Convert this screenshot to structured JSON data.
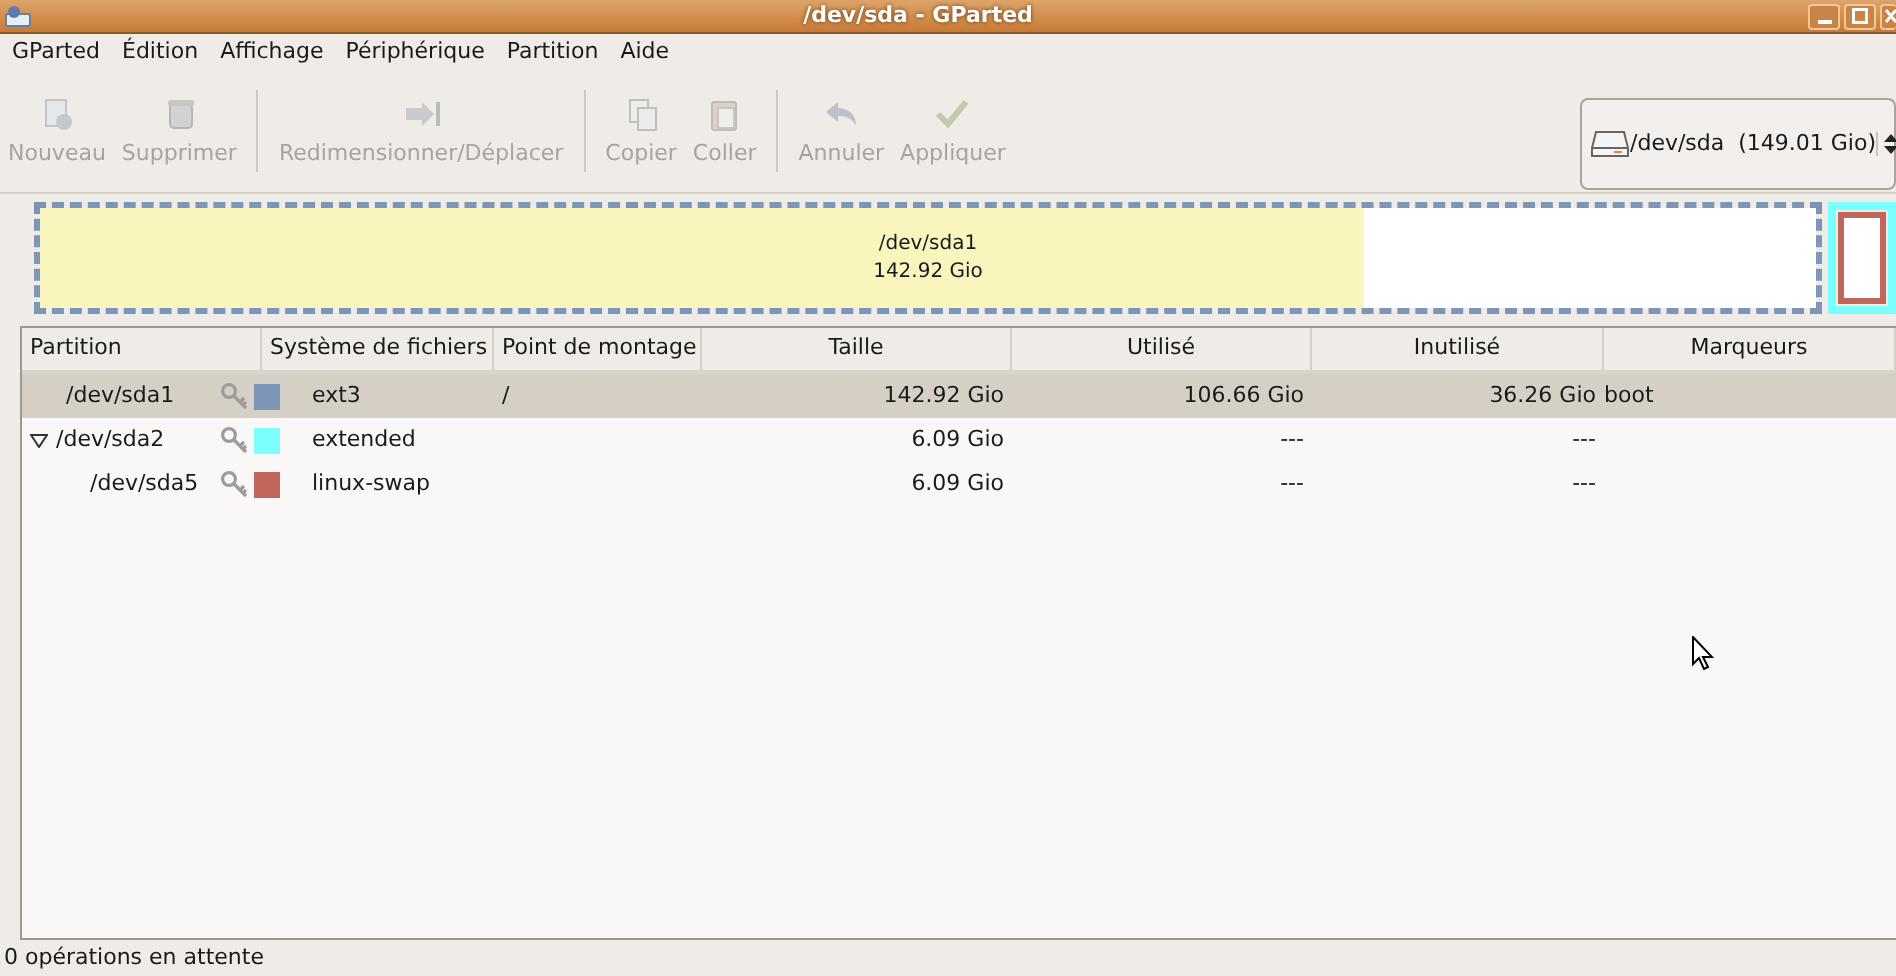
{
  "window": {
    "title": "/dev/sda - GParted"
  },
  "menu": [
    "GParted",
    "Édition",
    "Affichage",
    "Périphérique",
    "Partition",
    "Aide"
  ],
  "toolbar_groups": [
    [
      {
        "label": "Nouveau",
        "disabled": true
      },
      {
        "label": "Supprimer",
        "disabled": true
      }
    ],
    [
      {
        "label": "Redimensionner/Déplacer",
        "disabled": true
      }
    ],
    [
      {
        "label": "Copier",
        "disabled": true
      },
      {
        "label": "Coller",
        "disabled": true
      }
    ],
    [
      {
        "label": "Annuler",
        "disabled": true
      },
      {
        "label": "Appliquer",
        "disabled": true
      }
    ]
  ],
  "device": {
    "value": "/dev/sda  (149.01 Gio)"
  },
  "disk_map": [
    {
      "name": "/dev/sda1",
      "size": "142.92 Gio",
      "color": "#7b96b7",
      "level": 0.746,
      "selected": true
    },
    {
      "color": "#7bffff",
      "selected": false,
      "children": [
        {
          "color": "#c1665a",
          "selected": false
        }
      ]
    }
  ],
  "table": {
    "columns": [
      "Partition",
      "Système de fichiers",
      "Point de montage",
      "Taille",
      "Utilisé",
      "Inutilisé",
      "Marqueurs"
    ],
    "rows": [
      {
        "partition": "/dev/sda1",
        "color": "#7b96b7",
        "filesystem": "ext3",
        "mount": "/",
        "size": "142.92 Gio",
        "used": "106.66 Gio",
        "unused": "36.26 Gio",
        "flags": "boot",
        "selected": true
      },
      {
        "partition": "/dev/sda2",
        "color": "#7bffff",
        "filesystem": "extended",
        "size": "6.09 Gio",
        "used": "---",
        "unused": "---",
        "selected": false,
        "expanded": true,
        "children": [
          {
            "partition": "/dev/sda5",
            "color": "#c1665a",
            "filesystem": "linux-swap",
            "size": "6.09 Gio",
            "used": "---",
            "unused": "---",
            "selected": false
          }
        ]
      }
    ]
  },
  "status_bar": "0 opérations en attente"
}
